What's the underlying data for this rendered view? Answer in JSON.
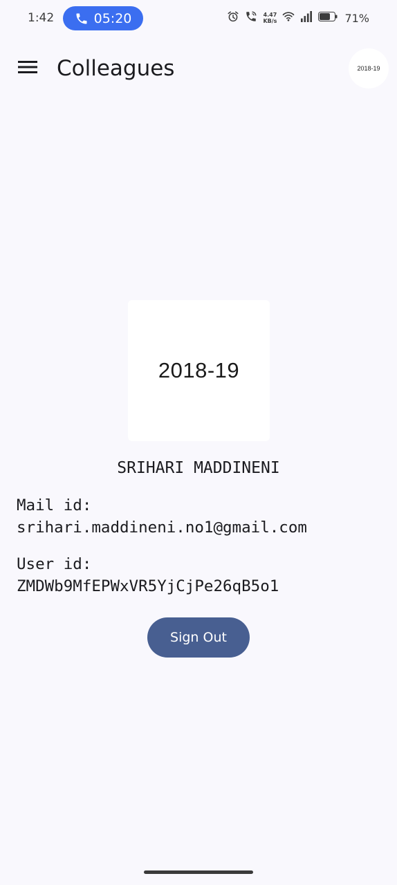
{
  "status_bar": {
    "time": "1:42",
    "call_timer": "05:20",
    "net_speed_value": "4.47",
    "net_speed_unit": "KB/s",
    "battery_percent": "71%",
    "icons": [
      "phone-icon",
      "alarm-icon",
      "wifi-calling-icon",
      "wifi-icon",
      "signal-icon",
      "battery-icon"
    ]
  },
  "app_bar": {
    "title": "Colleagues",
    "avatar_text": "2018-19",
    "menu_icon": "hamburger-menu-icon"
  },
  "profile": {
    "image_text": "2018-19",
    "name": "SRIHARI MADDINENI",
    "mail_label": "Mail id:",
    "mail_value": "srihari.maddineni.no1@gmail.com",
    "user_label": "User id:",
    "user_value": "ZMDWb9MfEPWxVR5YjCjPe26qB5o1",
    "sign_out_label": "Sign Out"
  },
  "colors": {
    "background": "#f9f8fd",
    "call_chip": "#3b6ef0",
    "button": "#485f91",
    "text": "#1b1b1f"
  }
}
